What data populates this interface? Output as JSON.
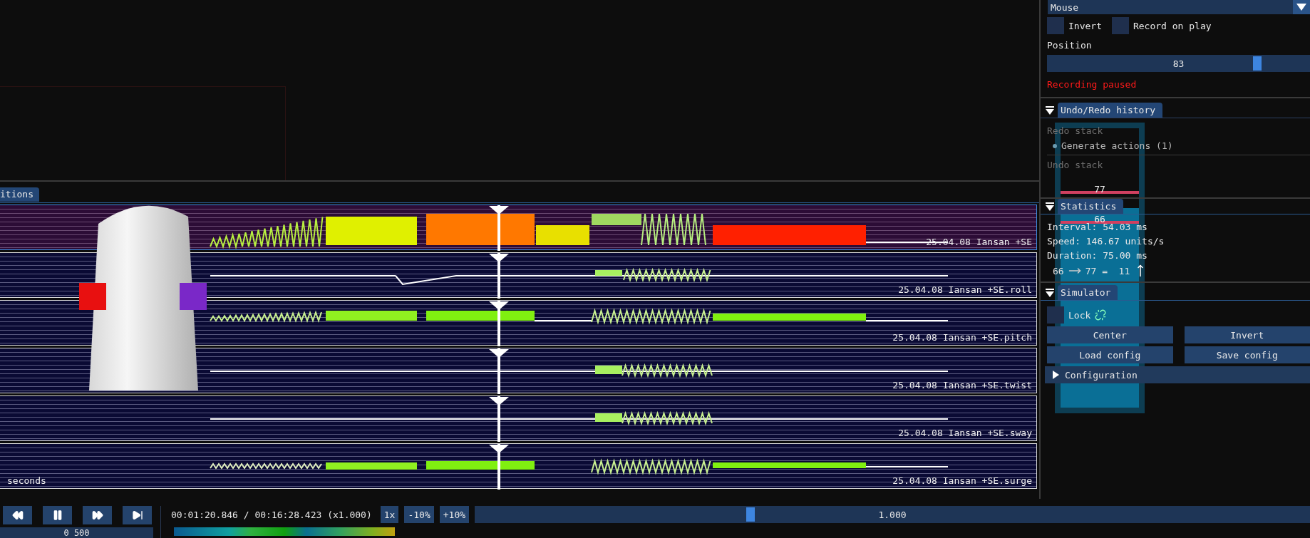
{
  "tracks": {
    "tab": {
      "label": "itions",
      "selected": true
    },
    "rows": [
      {
        "label": "25.04.08 Iansan +SE",
        "selected": true
      },
      {
        "label": "25.04.08 Iansan +SE.roll",
        "selected": false
      },
      {
        "label": "25.04.08 Iansan +SE.pitch",
        "selected": false
      },
      {
        "label": "25.04.08 Iansan +SE.twist",
        "selected": false
      },
      {
        "label": "25.04.08 Iansan +SE.sway",
        "selected": false
      },
      {
        "label": "25.04.08 Iansan +SE.surge",
        "selected": false
      }
    ],
    "axis_label": "seconds"
  },
  "recording": {
    "mode": "Mouse",
    "options": [
      {
        "label": "Invert",
        "checked": false
      },
      {
        "label": "Record on play",
        "checked": false
      }
    ],
    "position": {
      "label": "Position",
      "value": "83",
      "level": 0.8
    },
    "status": "Recording paused"
  },
  "undo_history": {
    "title": "Undo/Redo history",
    "expanded": true,
    "redo_label": "Redo stack",
    "redo_items": [
      "Generate actions (1)"
    ],
    "undo_label": "Undo stack"
  },
  "statistics": {
    "title": "Statistics",
    "expanded": true,
    "lines": [
      "Interval: 54.03 ms",
      "Speed: 146.67 units/s",
      "Duration: 75.00 ms"
    ],
    "change": {
      "from": "66",
      "rest": "77 =  11"
    }
  },
  "simulator": {
    "title": "Simulator",
    "expanded": true,
    "lock": {
      "label": "Lock",
      "checked": false
    },
    "buttons": [
      "Center",
      "Invert",
      "Load config",
      "Save config"
    ],
    "configuration": {
      "title": "Configuration",
      "expanded": false
    }
  },
  "simulator_overlay": {
    "upper": "77",
    "lower": "66"
  },
  "playback": {
    "transport": [
      {
        "kind": "rewind"
      },
      {
        "kind": "pause"
      },
      {
        "kind": "forward"
      },
      {
        "kind": "skip"
      }
    ],
    "step_field": {
      "value": "0 500"
    },
    "time": "00:01:20.846 / 00:16:28.423 (x1.000)",
    "speed_buttons": [
      "1x",
      "-10%",
      "+10%"
    ],
    "speed": {
      "value": "1.000",
      "level": 0.33
    }
  }
}
